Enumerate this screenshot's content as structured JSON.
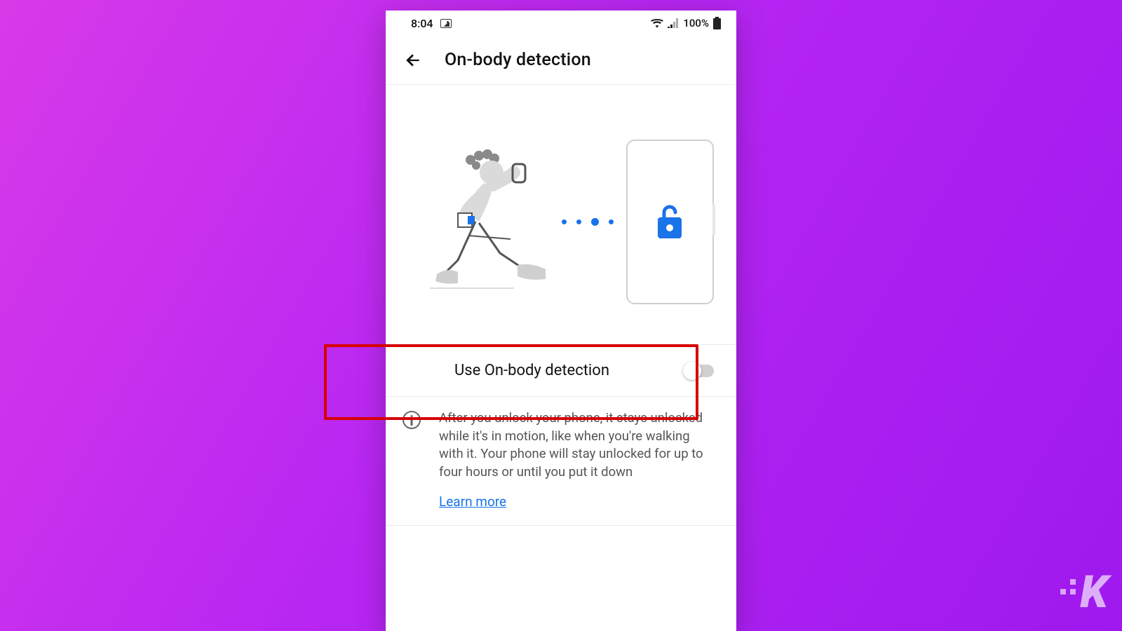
{
  "status": {
    "time": "8:04",
    "battery": "100%"
  },
  "header": {
    "title": "On-body detection"
  },
  "toggle": {
    "label": "Use On-body detection",
    "enabled": false
  },
  "info": {
    "text": "After you unlock your phone, it stays unlocked while it's in motion, like when you're walking with it. Your phone will stay unlocked for up to four hours or until you put it down",
    "learn_more": "Learn more"
  },
  "colors": {
    "accent": "#1a73e8",
    "highlight": "#d60000"
  },
  "watermark": "K"
}
